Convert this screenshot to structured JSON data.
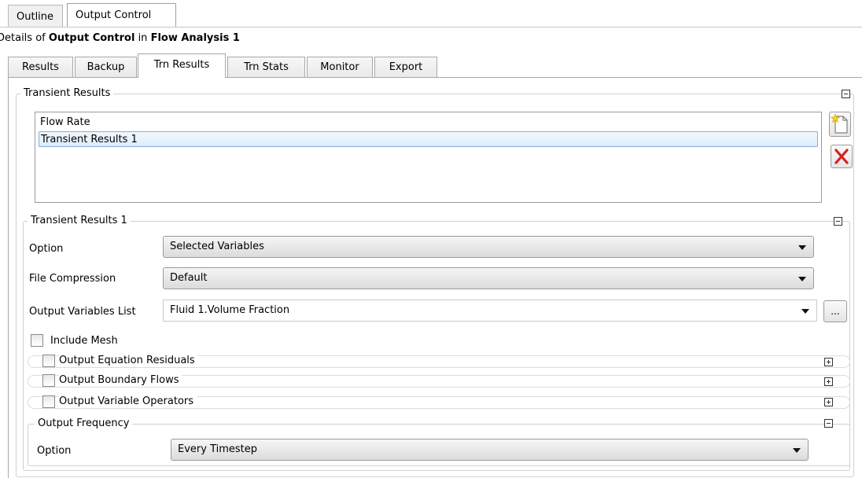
{
  "top_tabs": [
    {
      "label": "Outline",
      "active": false
    },
    {
      "label": "Output Control",
      "active": true
    }
  ],
  "details": {
    "prefix": "Details of ",
    "object": "Output Control",
    "middle": " in ",
    "parent": "Flow Analysis 1"
  },
  "sub_tabs": [
    {
      "label": "Results"
    },
    {
      "label": "Backup"
    },
    {
      "label": "Trn Results"
    },
    {
      "label": "Trn Stats"
    },
    {
      "label": "Monitor"
    },
    {
      "label": "Export"
    }
  ],
  "transient_results": {
    "title": "Transient Results",
    "items": [
      "Flow Rate",
      "Transient Results 1"
    ],
    "selected_index": 1
  },
  "transient_results_1": {
    "title": "Transient Results 1",
    "option_label": "Option",
    "option_value": "Selected Variables",
    "compression_label": "File Compression",
    "compression_value": "Default",
    "variables_label": "Output Variables List",
    "variables_value": "Fluid 1.Volume Fraction",
    "ellipsis": "...",
    "include_mesh": {
      "label": "Include Mesh",
      "checked": false
    },
    "output_equation_residuals": {
      "label": "Output Equation Residuals",
      "checked": false
    },
    "output_boundary_flows": {
      "label": "Output Boundary Flows",
      "checked": false
    },
    "output_variable_operators": {
      "label": "Output Variable Operators",
      "checked": false
    }
  },
  "output_frequency": {
    "title": "Output Frequency",
    "option_label": "Option",
    "option_value": "Every Timestep"
  },
  "colors": {
    "selection_border": "#84acdd",
    "delete_red": "#d42020",
    "new_star": "#f5d21b"
  }
}
